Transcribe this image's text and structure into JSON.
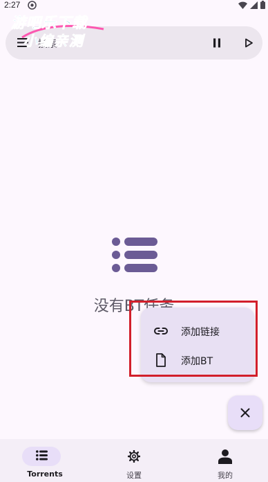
{
  "status_bar": {
    "time": "2:27"
  },
  "watermark": {
    "line1": "游吧乐下载",
    "line2": "小编亲测"
  },
  "search": {
    "placeholder": "搜索"
  },
  "empty_state": {
    "text": "没有BT任务"
  },
  "popup_menu": {
    "items": [
      {
        "label": "添加链接",
        "icon": "link-icon"
      },
      {
        "label": "添加BT",
        "icon": "file-icon"
      }
    ]
  },
  "bottom_nav": {
    "items": [
      {
        "label": "Torrents",
        "icon": "list-icon",
        "active": true
      },
      {
        "label": "设置",
        "icon": "gear-icon",
        "active": false
      },
      {
        "label": "我的",
        "icon": "person-icon",
        "active": false
      }
    ]
  },
  "colors": {
    "accent": "#6b5b95",
    "highlight": "#d21f2b",
    "watermark": "#1ab0e8"
  }
}
